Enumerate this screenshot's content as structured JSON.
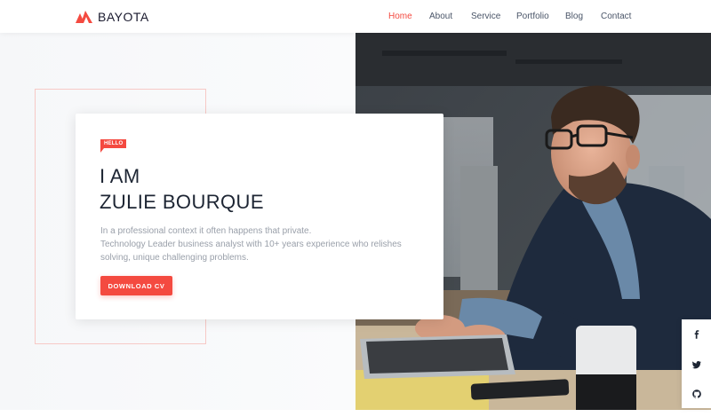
{
  "brand": {
    "name": "BAYOTA",
    "accent": "#f44a40"
  },
  "nav": {
    "items": [
      {
        "label": "Home",
        "active": true
      },
      {
        "label": "About",
        "active": false
      },
      {
        "label": "Service",
        "active": false
      },
      {
        "label": "Portfolio",
        "active": false
      },
      {
        "label": "Blog",
        "active": false
      },
      {
        "label": "Contact",
        "active": false
      }
    ]
  },
  "hero": {
    "badge": "HELLO",
    "headline_line1": "I AM",
    "headline_line2": "ZULIE BOURQUE",
    "description_line1": "In a professional context it often happens that private.",
    "description_line2": "Technology Leader business analyst with 10+ years experience who relishes",
    "description_line3": "solving, unique challenging problems.",
    "cta_label": "DOWNLOAD CV",
    "photo_icon": "man-typing-on-laptop-photo"
  },
  "social": {
    "items": [
      {
        "icon": "facebook-icon"
      },
      {
        "icon": "twitter-icon"
      },
      {
        "icon": "github-icon"
      }
    ]
  }
}
